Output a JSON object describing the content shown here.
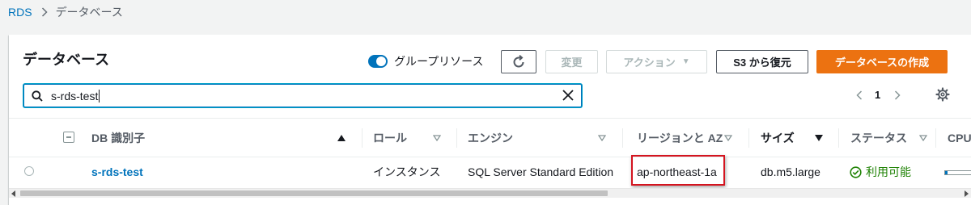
{
  "breadcrumb": {
    "root": "RDS",
    "current": "データベース"
  },
  "panel": {
    "title": "データベース",
    "group_toggle": {
      "label": "グループリソース",
      "on": true
    },
    "buttons": {
      "refresh_icon": "refresh-icon",
      "modify": "変更",
      "actions": "アクション",
      "restore_s3": "S3 から復元",
      "create": "データベースの作成"
    },
    "search": {
      "value": "s-rds-test"
    },
    "pagination": {
      "page": "1"
    }
  },
  "table": {
    "columns": {
      "db_id": "DB 識別子",
      "role": "ロール",
      "engine": "エンジン",
      "region": "リージョンと AZ",
      "size": "サイズ",
      "status": "ステータス",
      "cpu": "CPU"
    },
    "rows": [
      {
        "db_id": "s-rds-test",
        "role": "インスタンス",
        "engine": "SQL Server Standard Edition",
        "region": "ap-northeast-1a",
        "size": "db.m5.large",
        "status": "利用可能"
      }
    ]
  },
  "colors": {
    "accent": "#0073bb",
    "primary": "#ec7211",
    "success": "#1d8102",
    "highlight": "#d4141f"
  }
}
